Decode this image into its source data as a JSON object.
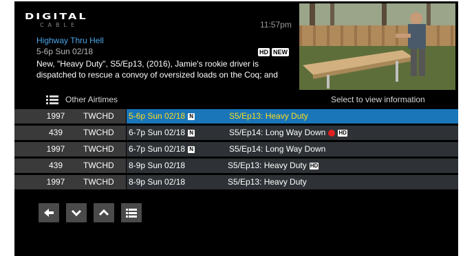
{
  "header": {
    "logo_main": "DIGITAL",
    "logo_sub": "CABLE",
    "clock": "11:57pm"
  },
  "program": {
    "title": "Highway Thru Hell",
    "time": "5-6p Sun  02/18",
    "badges": [
      "HD",
      "NEW"
    ],
    "description": "New, \"Heavy Duty\", S5/Ep13,  (2016), Jamie's rookie driver is dispatched to rescue a convoy of oversized loads on the Coq; and"
  },
  "list_header": {
    "label": "Other Airtimes",
    "hint": "Select to view information"
  },
  "airtimes": [
    {
      "channel": "1997",
      "network": "TWCHD",
      "time": "5-6p Sun  02/18",
      "badge": "N",
      "episode": "S5/Ep13:  Heavy Duty",
      "recording": false,
      "hd": false,
      "selected": true
    },
    {
      "channel": "439",
      "network": "TWCHD",
      "time": "6-7p Sun  02/18",
      "badge": "N",
      "episode": "S5/Ep14:  Long Way Down",
      "recording": true,
      "hd": true,
      "selected": false
    },
    {
      "channel": "1997",
      "network": "TWCHD",
      "time": "6-7p Sun  02/18",
      "badge": "N",
      "episode": "S5/Ep14:  Long Way Down",
      "recording": false,
      "hd": false,
      "selected": false
    },
    {
      "channel": "439",
      "network": "TWCHD",
      "time": "8-9p Sun  02/18",
      "badge": "",
      "episode": "S5/Ep13:  Heavy Duty",
      "recording": false,
      "hd": true,
      "selected": false
    },
    {
      "channel": "1997",
      "network": "TWCHD",
      "time": "8-9p Sun  02/18",
      "badge": "",
      "episode": "S5/Ep13:  Heavy Duty",
      "recording": false,
      "hd": false,
      "selected": false
    }
  ],
  "hd_label": "HD",
  "nav_buttons": [
    {
      "icon": "arrow-left-icon"
    },
    {
      "icon": "chevron-down-icon"
    },
    {
      "icon": "chevron-up-icon"
    },
    {
      "icon": "list-icon"
    }
  ],
  "colors": {
    "accent_title": "#4aa6e8",
    "selected_row": "#1a76b8",
    "selected_text": "#ffdd1e",
    "record_dot": "#e02020"
  }
}
